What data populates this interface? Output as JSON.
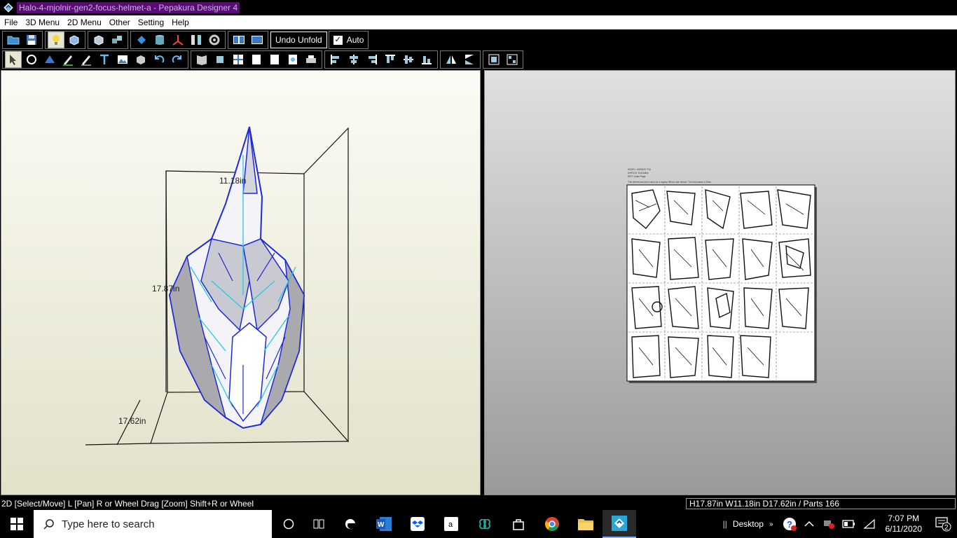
{
  "window": {
    "title": "Halo-4-mjolnir-gen2-focus-helmet-a - Pepakura Designer 4"
  },
  "menu": [
    "File",
    "3D Menu",
    "2D Menu",
    "Other",
    "Setting",
    "Help"
  ],
  "toolbar": {
    "undo_unfold": "Undo Unfold",
    "auto": "Auto"
  },
  "model": {
    "dim_width": "11.18in",
    "dim_height": "17.87in",
    "dim_depth": "17.62in",
    "sheet_header": [
      "MODEL: MONKEY FILI",
      "UNFOLD: DocGalley",
      "EDIT: Julian Papa",
      "This helmet has been sized for a regular 280cm size helmet. The font makes it 30cm"
    ]
  },
  "status": {
    "left": "2D [Select/Move] L [Pan] R or Wheel Drag [Zoom] Shift+R or Wheel",
    "right": "H17.87in W11.18in D17.62in / Parts 166"
  },
  "taskbar": {
    "search_placeholder": "Type here to search",
    "desktop_label": "Desktop",
    "time": "7:07 PM",
    "date": "6/11/2020",
    "notification_count": "2"
  }
}
